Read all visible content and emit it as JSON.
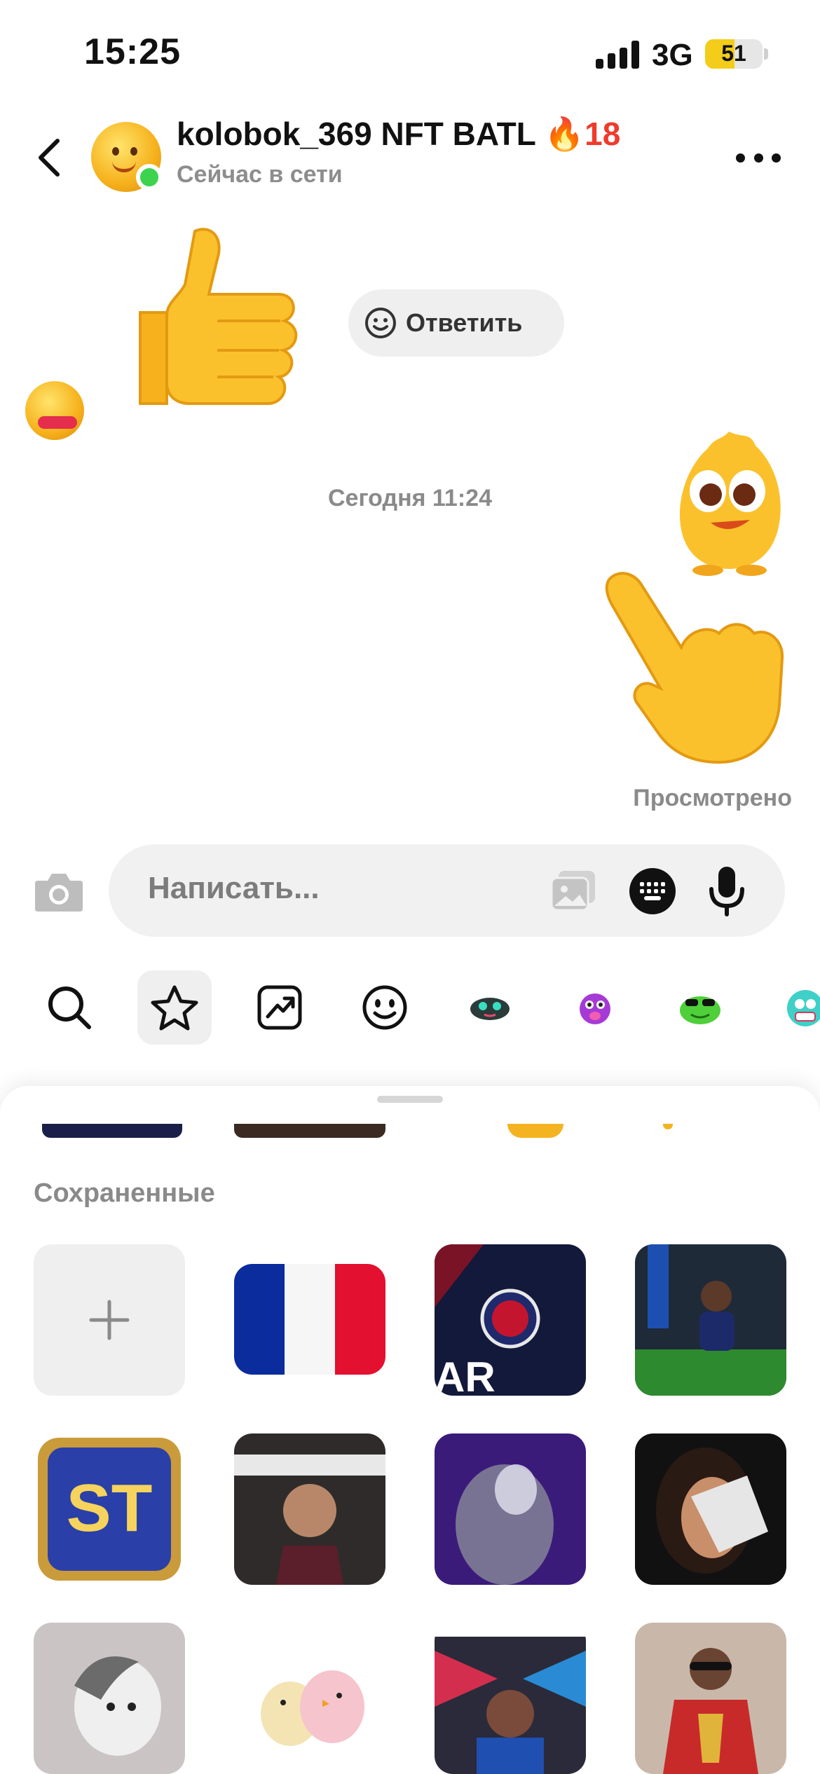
{
  "status_bar": {
    "time": "15:25",
    "network": "3G",
    "battery": "51",
    "battery_level": 0.51
  },
  "header": {
    "back_icon": "chevron-left-icon",
    "title": "kolobok_369 NFT BATL ",
    "streak_emoji": "🔥",
    "streak_count": "18",
    "status": "Сейчас в сети",
    "more_icon": "more-horizontal-icon"
  },
  "chat": {
    "reply_label": "Ответить",
    "timestamp": "Сегодня 11:24",
    "seen_label": "Просмотрено",
    "stickers": [
      "thumbs-up-sticker",
      "yellow-mascot-sticker",
      "pointing-hand-sticker"
    ]
  },
  "composer": {
    "placeholder": "Написать...",
    "icons": [
      "camera-icon",
      "gallery-icon",
      "keyboard-icon",
      "microphone-icon"
    ]
  },
  "category_tabs": [
    {
      "name": "search-icon",
      "active": false
    },
    {
      "name": "star-icon",
      "active": true
    },
    {
      "name": "trending-icon",
      "active": false
    },
    {
      "name": "smiley-icon",
      "active": false
    },
    {
      "name": "creature-pack-icon",
      "active": false
    },
    {
      "name": "purple-monster-pack-icon",
      "active": false
    },
    {
      "name": "frog-pack-icon",
      "active": false
    },
    {
      "name": "teal-monster-pack-icon",
      "active": false
    }
  ],
  "saved": {
    "title": "Сохраненные",
    "add_icon": "plus-icon",
    "items": [
      {
        "name": "france-flag-sticker"
      },
      {
        "name": "psg-jersey-sticker"
      },
      {
        "name": "footballer-kneeling-sticker"
      },
      {
        "name": "st-badge-sticker",
        "text": "ST"
      },
      {
        "name": "footballer-portrait-sticker"
      },
      {
        "name": "blurred-person-sticker"
      },
      {
        "name": "glitter-face-sticker"
      },
      {
        "name": "baby-character-sticker"
      },
      {
        "name": "chicks-sticker"
      },
      {
        "name": "painted-face-sticker"
      },
      {
        "name": "trophy-player-sticker"
      }
    ]
  },
  "colors": {
    "online": "#3ed34f",
    "streak": "#ef3b2c",
    "battery": "#f3cd1a",
    "muted_text": "#8a8a8a",
    "pill_bg": "#f1f1f1"
  }
}
